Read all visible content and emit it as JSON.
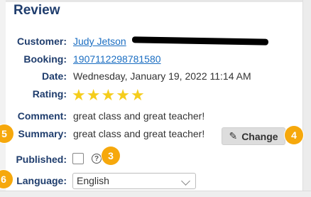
{
  "panel": {
    "title": "Review"
  },
  "fields": {
    "customer": {
      "label": "Customer:",
      "name": "Judy Jetson",
      "email": "[redacted email]"
    },
    "booking": {
      "label": "Booking:",
      "value": "1907112298781580"
    },
    "date": {
      "label": "Date:",
      "value": "Wednesday, January 19, 2022 11:14 AM"
    },
    "rating": {
      "label": "Rating:",
      "value": 5,
      "max": 5,
      "icon": "star-icon",
      "color": "#f5cd1c"
    },
    "comment": {
      "label": "Comment:",
      "value": "great class and great teacher!"
    },
    "summary": {
      "label": "Summary:",
      "value": "great class and great teacher!"
    },
    "published": {
      "label": "Published:",
      "checked": false,
      "help_icon": "question-circle-icon"
    },
    "language": {
      "label": "Language:",
      "selected": "English"
    }
  },
  "change_button": {
    "label": "Change",
    "icon": "pencil-icon"
  },
  "callouts": {
    "b3": "3",
    "b4": "4",
    "b5": "5",
    "b6": "6",
    "color": "#f6a80c"
  }
}
